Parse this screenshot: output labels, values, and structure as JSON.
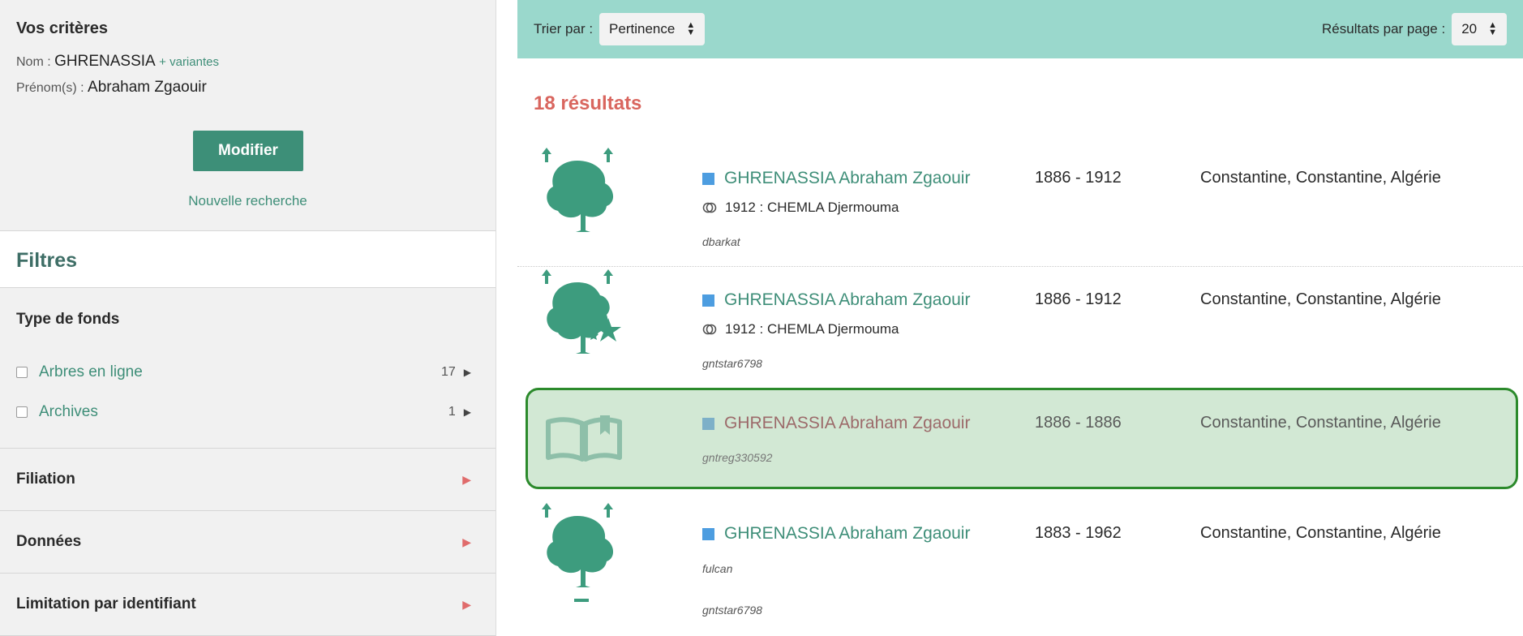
{
  "criteria": {
    "title": "Vos critères",
    "nom_label": "Nom :",
    "nom_value": "GHRENASSIA",
    "variantes_link": "+ variantes",
    "prenom_label": "Prénom(s) :",
    "prenom_value": "Abraham Zgaouir",
    "modify_button": "Modifier",
    "new_search_link": "Nouvelle recherche"
  },
  "filters": {
    "title": "Filtres",
    "fonds_title": "Type de fonds",
    "fonds_items": [
      {
        "label": "Arbres en ligne",
        "count": "17"
      },
      {
        "label": "Archives",
        "count": "1"
      }
    ],
    "sections": [
      "Filiation",
      "Données",
      "Limitation par identifiant"
    ]
  },
  "toolbar": {
    "sort_label": "Trier par :",
    "sort_value": "Pertinence",
    "per_page_label": "Résultats par page :",
    "per_page_value": "20"
  },
  "results_count": "18 résultats",
  "results": [
    {
      "name": "GHRENASSIA Abraham Zgaouir",
      "years": "1886 - 1912",
      "place": "Constantine, Constantine, Algérie",
      "union": "1912 : CHEMLA Djermouma",
      "source": "dbarkat",
      "icon": "tree-icon"
    },
    {
      "name": "GHRENASSIA Abraham Zgaouir",
      "years": "1886 - 1912",
      "place": "Constantine, Constantine, Algérie",
      "union": "1912 : CHEMLA Djermouma",
      "source": "gntstar6798",
      "icon": "tree-star-icon"
    },
    {
      "name": "GHRENASSIA Abraham Zgaouir",
      "years": "1886 - 1886",
      "place": "Constantine, Constantine, Algérie",
      "source": "gntreg330592",
      "icon": "open-book-icon"
    },
    {
      "name": "GHRENASSIA Abraham Zgaouir",
      "years": "1883 - 1962",
      "place": "Constantine, Constantine, Algérie",
      "source": "fulcan",
      "source2": "gntstar6798",
      "icon": "tree-icon"
    }
  ],
  "colors": {
    "accent": "#3d8f78",
    "toolbar_bg": "#9ad8cc",
    "count_red": "#d9665f",
    "highlight_border": "#2c8a2c",
    "highlight_bg": "#d2e8d4"
  }
}
